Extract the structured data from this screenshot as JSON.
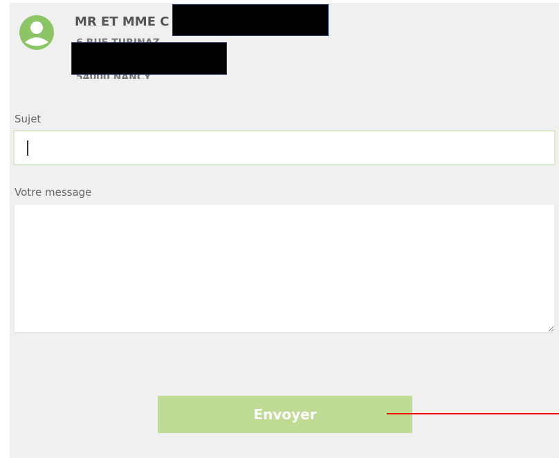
{
  "recipient": {
    "name": "MR ET MME C",
    "address_line_1_partial": "6 RUE TURINAZ",
    "address_line_2_partial": "54000 NANCY"
  },
  "form": {
    "subject_label": "Sujet",
    "subject_value": "",
    "message_label": "Votre message",
    "message_value": "",
    "send_label": "Envoyer"
  },
  "colors": {
    "accent": "#8bc565",
    "button": "#c0dc94",
    "panel_background": "#f0f0f0",
    "annotation": "#ff0000"
  },
  "icons": {
    "avatar": "user-circle-icon"
  }
}
